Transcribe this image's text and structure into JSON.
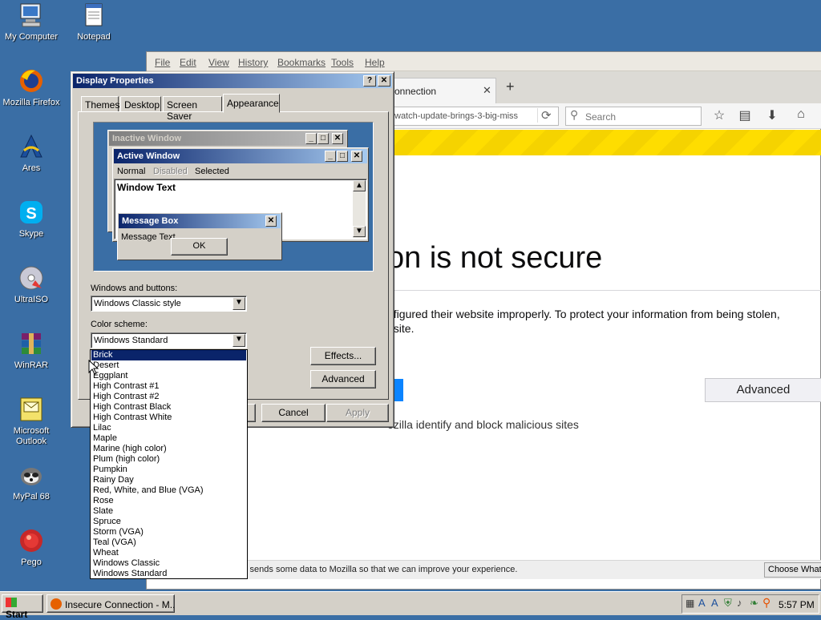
{
  "desktop": {
    "icons": [
      {
        "label": "My Computer",
        "icon": "my-computer-icon"
      },
      {
        "label": "Notepad",
        "icon": "notepad-icon"
      },
      {
        "label": "Mozilla Firefox",
        "icon": "firefox-icon"
      },
      {
        "label": "Ares",
        "icon": "ares-icon"
      },
      {
        "label": "Skype",
        "icon": "skype-icon"
      },
      {
        "label": "UltraISO",
        "icon": "ultraiso-icon"
      },
      {
        "label": "WinRAR",
        "icon": "winrar-icon"
      },
      {
        "label": "Microsoft Outlook",
        "icon": "outlook-icon"
      },
      {
        "label": "MyPal 68",
        "icon": "mypal-icon"
      },
      {
        "label": "Pego",
        "icon": "pego-icon"
      }
    ]
  },
  "browser": {
    "menu": [
      "File",
      "Edit",
      "View",
      "History",
      "Bookmarks",
      "Tools",
      "Help"
    ],
    "tab_title": "onnection",
    "url": "watch-update-brings-3-big-miss",
    "search_placeholder": "Search",
    "heading": "on is not secure",
    "body_line1": "nfigured their website improperly. To protect your information from being stolen,",
    "body_line2": "osite.",
    "advanced_button": "Advanced",
    "report_text": "ozilla identify and block malicious sites",
    "notice_text": "y sends some data to Mozilla so that we can improve your experience.",
    "choose_button": "Choose What",
    "colors": {
      "warning_stripe": "#fedd00",
      "primary_button": "#0a84ff"
    }
  },
  "dialog": {
    "title": "Display Properties",
    "title_buttons": [
      "?",
      "✕"
    ],
    "tabs": [
      "Themes",
      "Desktop",
      "Screen Saver",
      "Appearance"
    ],
    "active_tab": "Appearance",
    "preview": {
      "inactive_title": "Inactive Window",
      "active_title": "Active Window",
      "menu": [
        "Normal",
        "Disabled",
        "Selected"
      ],
      "window_text": "Window Text",
      "msgbox_title": "Message Box",
      "msgbox_text": "Message Text",
      "ok": "OK"
    },
    "windows_buttons_label": "Windows and buttons:",
    "windows_buttons_value": "Windows Classic style",
    "color_scheme_label": "Color scheme:",
    "color_scheme_value": "Windows Standard",
    "effects_button": "Effects...",
    "advanced_button": "Advanced",
    "cancel_button": "Cancel",
    "apply_button": "Apply",
    "color_scheme_options": [
      "Brick",
      "Desert",
      "Eggplant",
      "High Contrast #1",
      "High Contrast #2",
      "High Contrast Black",
      "High Contrast White",
      "Lilac",
      "Maple",
      "Marine (high color)",
      "Plum (high color)",
      "Pumpkin",
      "Rainy Day",
      "Red, White, and Blue (VGA)",
      "Rose",
      "Slate",
      "Spruce",
      "Storm (VGA)",
      "Teal (VGA)",
      "Wheat",
      "Windows Classic",
      "Windows Standard"
    ],
    "highlighted_option": "Brick"
  },
  "taskbar": {
    "start": "Start",
    "task": "Insecure Connection - M...",
    "clock": "5:57 PM"
  }
}
